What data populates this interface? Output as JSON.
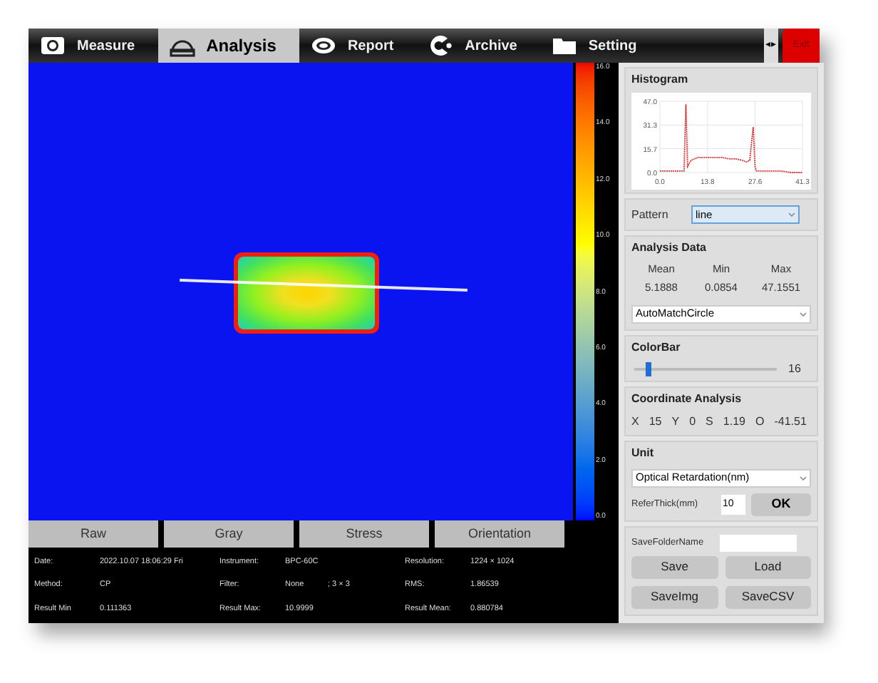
{
  "tabs": [
    {
      "label": "Measure",
      "selected": false
    },
    {
      "label": "Analysis",
      "selected": true
    },
    {
      "label": "Report",
      "selected": false
    },
    {
      "label": "Archive",
      "selected": false
    },
    {
      "label": "Setting",
      "selected": false
    }
  ],
  "scroll_arrows": [
    "◂",
    "▸"
  ],
  "exit_button": "Exit",
  "colorbar_ticks": [
    "16.0",
    "14.0",
    "12.0",
    "10.0",
    "8.0",
    "6.0",
    "4.0",
    "2.0",
    "0.0"
  ],
  "view_buttons": [
    "Raw",
    "Gray",
    "Stress",
    "Orientation"
  ],
  "info": [
    [
      {
        "label": "Date:",
        "value": "2022.10.07 18:06:29 Fri"
      },
      {
        "label": "Instrument:",
        "value": "BPC-60C"
      },
      {
        "label": "Resolution:",
        "value": "1224 × 1024"
      }
    ],
    [
      {
        "label": "Method:",
        "value": "CP"
      },
      {
        "label": "Filter:",
        "value": "None",
        "extra": "; 3 × 3"
      },
      {
        "label": "RMS:",
        "value": "1.86539"
      }
    ],
    [
      {
        "label": "Result Min",
        "value": "0.111363"
      },
      {
        "label": "Result Max:",
        "value": "10.9999"
      },
      {
        "label": "Result Mean:",
        "value": "0.880784"
      }
    ]
  ],
  "histogram": {
    "title": "Histogram",
    "chart_data": {
      "type": "line",
      "x": [
        0,
        2,
        4,
        6,
        7,
        7.5,
        8,
        9,
        11,
        13.8,
        16,
        18,
        20,
        22,
        24,
        25,
        26,
        27,
        27.6,
        28,
        29,
        32,
        35,
        38,
        41.3
      ],
      "grid": true,
      "series": [
        {
          "color": "#e03030",
          "line_style": "dashed",
          "values": [
            1,
            1,
            1,
            1,
            1,
            45,
            4,
            8,
            10,
            10,
            10,
            10,
            9,
            9,
            8,
            7,
            8,
            30,
            3,
            1,
            1,
            1,
            1,
            0,
            0
          ]
        }
      ],
      "xlim": [
        0,
        41.3
      ],
      "ylim": [
        0,
        47
      ],
      "xticks": [
        {
          "value": 0,
          "label": "0.0"
        },
        {
          "value": 13.8,
          "label": "13.8"
        },
        {
          "value": 27.6,
          "label": "27.6"
        },
        {
          "value": 41.3,
          "label": "41.3"
        }
      ],
      "yticks": [
        {
          "value": 0,
          "label": "0.0"
        },
        {
          "value": 15.7,
          "label": "15.7"
        },
        {
          "value": 31.3,
          "label": "31.3"
        },
        {
          "value": 47,
          "label": "47.0"
        }
      ]
    }
  },
  "pattern": {
    "label": "Pattern",
    "value": "line"
  },
  "analysis_data": {
    "title": "Analysis Data",
    "columns": [
      {
        "label": "Mean",
        "value": "5.1888"
      },
      {
        "label": "Min",
        "value": "0.0854"
      },
      {
        "label": "Max",
        "value": "47.1551"
      }
    ],
    "mode": "AutoMatchCircle"
  },
  "colorbar": {
    "title": "ColorBar",
    "level": 0.1,
    "reading": "16"
  },
  "coordinate_analysis": {
    "title": "Coordinate Analysis",
    "items": [
      "X",
      "15",
      "Y",
      "0",
      "S",
      "1.19",
      "O",
      "-41.51"
    ]
  },
  "unit": {
    "title": "Unit",
    "value": "Optical Retardation(nm)",
    "thickness_label": "ReferThick(mm)",
    "thickness": "10",
    "ok_button": "OK"
  },
  "save": {
    "folder_label": "SaveFolderName",
    "buttons": [
      "Save",
      "Load",
      "SaveImg",
      "SaveCSV"
    ]
  }
}
